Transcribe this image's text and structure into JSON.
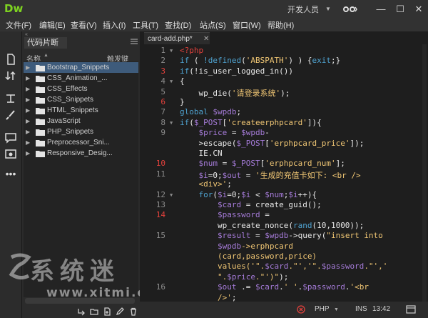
{
  "app": {
    "logo": "Dw",
    "workspace": "开发人员",
    "colors": {
      "accent": "#7ed321",
      "error": "#e2413c",
      "selection": "#3e5b7b"
    }
  },
  "window_controls": [
    "—",
    "☐",
    "✕"
  ],
  "menu": [
    "文件(F)",
    "编辑(E)",
    "查看(V)",
    "插入(I)",
    "工具(T)",
    "查找(D)",
    "站点(S)",
    "窗口(W)",
    "帮助(H)"
  ],
  "panel": {
    "tab": "代码片断",
    "col_name": "名称",
    "col_shortcut": "触发键",
    "items": [
      {
        "label": "Bootstrap_Snippets",
        "selected": true
      },
      {
        "label": "CSS_Animation_...",
        "selected": false
      },
      {
        "label": "CSS_Effects",
        "selected": false
      },
      {
        "label": "CSS_Snippets",
        "selected": false
      },
      {
        "label": "HTML_Snippets",
        "selected": false
      },
      {
        "label": "JavaScript",
        "selected": false
      },
      {
        "label": "PHP_Snippets",
        "selected": false
      },
      {
        "label": "Preprocessor_Sni...",
        "selected": false
      },
      {
        "label": "Responsive_Desig...",
        "selected": false
      }
    ]
  },
  "watermark": {
    "text": "系统迷",
    "url": "www.xitmi.com"
  },
  "editor": {
    "tab": "card-add.php*",
    "lines": [
      {
        "n": "1",
        "err": false,
        "fold": true,
        "html": "<span style='color:#e2413c'>&lt;?php</span>"
      },
      {
        "n": "2",
        "err": false,
        "fold": false,
        "html": "<span style='color:#4fa3d1'>if</span> ( <span style='color:#4fa3d1'>!defined</span>(<span style='color:#f0c674'>'ABSPATH'</span>) ) {<span style='color:#4fa3d1'>exit</span>;}"
      },
      {
        "n": "3",
        "err": true,
        "fold": false,
        "html": "<span style='color:#4fa3d1'>if</span>(!is_user_logged_in())"
      },
      {
        "n": "4",
        "err": false,
        "fold": true,
        "html": "{"
      },
      {
        "n": "5",
        "err": false,
        "fold": false,
        "html": "    wp_die(<span style='color:#f0c674'>'请登录系统'</span>);"
      },
      {
        "n": "6",
        "err": true,
        "fold": false,
        "html": "}"
      },
      {
        "n": "7",
        "err": false,
        "fold": false,
        "html": "<span style='color:#4fa3d1'>global</span> <span style='color:#a57bd8'>$wpdb</span>;"
      },
      {
        "n": "8",
        "err": false,
        "fold": true,
        "html": "<span style='color:#4fa3d1'>if</span>(<span style='color:#a57bd8'>$_POST</span>[<span style='color:#f0c674'>'createerphpcard'</span>]){"
      },
      {
        "n": "9",
        "err": false,
        "fold": false,
        "html": "    <span style='color:#a57bd8'>$price</span> = <span style='color:#a57bd8'>$wpdb</span>-"
      },
      {
        "n": "",
        "err": false,
        "fold": false,
        "html": "    &gt;escape(<span style='color:#a57bd8'>$_POST</span>[<span style='color:#f0c674'>'erphpcard_price'</span>]);"
      },
      {
        "n": "",
        "err": false,
        "fold": false,
        "html": "    IE.CN"
      },
      {
        "n": "10",
        "err": true,
        "fold": false,
        "html": "    <span style='color:#a57bd8'>$num</span> = <span style='color:#a57bd8'>$_POST</span>[<span style='color:#f0c674'>'erphpcard_num'</span>];"
      },
      {
        "n": "11",
        "err": false,
        "fold": false,
        "html": "    <span style='color:#a57bd8'>$i</span>=0;<span style='color:#a57bd8'>$out</span> = <span style='color:#f0c674'>'生成的充值卡如下: &lt;br /&gt;</span>"
      },
      {
        "n": "",
        "err": false,
        "fold": false,
        "html": "    <span style='color:#f0c674'>&lt;div&gt;'</span>;"
      },
      {
        "n": "12",
        "err": false,
        "fold": true,
        "html": "    <span style='color:#4fa3d1'>for</span>(<span style='color:#a57bd8'>$i</span>=0;<span style='color:#a57bd8'>$i</span> &lt; <span style='color:#a57bd8'>$num</span>;<span style='color:#a57bd8'>$i</span>++){"
      },
      {
        "n": "13",
        "err": false,
        "fold": false,
        "html": "        <span style='color:#a57bd8'>$card</span> = create_guid();"
      },
      {
        "n": "14",
        "err": true,
        "fold": false,
        "html": "        <span style='color:#a57bd8'>$password</span> ="
      },
      {
        "n": "",
        "err": false,
        "fold": false,
        "html": "        wp_create_nonce(<span style='color:#4fa3d1'>rand</span>(10,1000));"
      },
      {
        "n": "15",
        "err": false,
        "fold": false,
        "html": "        <span style='color:#a57bd8'>$result</span> = <span style='color:#a57bd8'>$wpdb</span>-&gt;query(<span style='color:#f0c674'>\"insert into</span>"
      },
      {
        "n": "",
        "err": false,
        "fold": false,
        "html": "        <span style='color:#a57bd8'>$wpdb</span><span style='color:#f0c674'>-&gt;erphpcard</span>"
      },
      {
        "n": "",
        "err": false,
        "fold": false,
        "html": "        <span style='color:#f0c674'>(card,password,price)</span>"
      },
      {
        "n": "",
        "err": false,
        "fold": false,
        "html": "        <span style='color:#f0c674'>values('\".</span><span style='color:#a57bd8'>$card</span><span style='color:#f0c674'>.\"','\".</span><span style='color:#a57bd8'>$password</span><span style='color:#f0c674'>.\"','</span>"
      },
      {
        "n": "",
        "err": false,
        "fold": false,
        "html": "        <span style='color:#f0c674'>\".</span><span style='color:#a57bd8'>$price</span><span style='color:#f0c674'>.\"')\"</span>);"
      },
      {
        "n": "16",
        "err": false,
        "fold": false,
        "html": "        <span style='color:#a57bd8'>$out</span> .= <span style='color:#a57bd8'>$card</span>.<span style='color:#f0c674'>' '</span>.<span style='color:#a57bd8'>$password</span>.<span style='color:#f0c674'>'&lt;br</span>"
      },
      {
        "n": "",
        "err": false,
        "fold": false,
        "html": "        <span style='color:#f0c674'>/&gt;'</span>;"
      }
    ]
  },
  "status": {
    "language": "PHP",
    "mode": "INS",
    "position": "13:42"
  }
}
